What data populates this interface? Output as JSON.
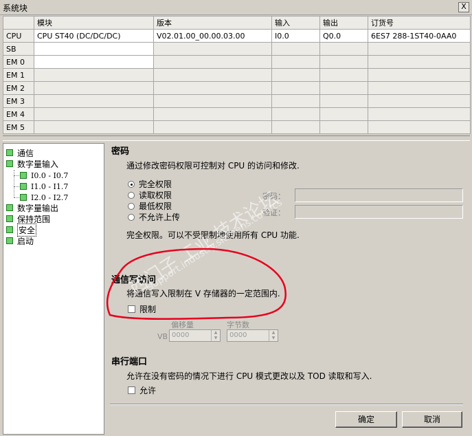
{
  "window": {
    "title": "系统块",
    "close_glyph": "X"
  },
  "grid": {
    "headers": [
      "",
      "模块",
      "版本",
      "输入",
      "输出",
      "订货号"
    ],
    "rows": [
      {
        "slot": "CPU",
        "module": "CPU ST40 (DC/DC/DC)",
        "version": "V02.01.00_00.00.03.00",
        "input": "I0.0",
        "output": "Q0.0",
        "order": "6ES7 288-1ST40-0AA0"
      },
      {
        "slot": "SB",
        "module": "",
        "version": "",
        "input": "",
        "output": "",
        "order": ""
      },
      {
        "slot": "EM 0",
        "module": "",
        "version": "",
        "input": "",
        "output": "",
        "order": ""
      },
      {
        "slot": "EM 1",
        "module": "",
        "version": "",
        "input": "",
        "output": "",
        "order": ""
      },
      {
        "slot": "EM 2",
        "module": "",
        "version": "",
        "input": "",
        "output": "",
        "order": ""
      },
      {
        "slot": "EM 3",
        "module": "",
        "version": "",
        "input": "",
        "output": "",
        "order": ""
      },
      {
        "slot": "EM 4",
        "module": "",
        "version": "",
        "input": "",
        "output": "",
        "order": ""
      },
      {
        "slot": "EM 5",
        "module": "",
        "version": "",
        "input": "",
        "output": "",
        "order": ""
      }
    ]
  },
  "tree": {
    "items": [
      {
        "label": "通信",
        "level": 0
      },
      {
        "label": "数字量输入",
        "level": 0
      },
      {
        "label": "I0.0 - I0.7",
        "level": 1
      },
      {
        "label": "I1.0 - I1.7",
        "level": 1
      },
      {
        "label": "I2.0 - I2.7",
        "level": 1
      },
      {
        "label": "数字量输出",
        "level": 0
      },
      {
        "label": "保持范围",
        "level": 0
      },
      {
        "label": "安全",
        "level": 0,
        "selected": true
      },
      {
        "label": "启动",
        "level": 0
      }
    ]
  },
  "password": {
    "title": "密码",
    "description": "通过修改密码权限可控制对 CPU 的访问和修改.",
    "options": [
      "完全权限",
      "读取权限",
      "最低权限",
      "不允许上传"
    ],
    "selected_index": 0,
    "password_label": "密码：",
    "verify_label": "验证：",
    "status": "完全权限。可以不受限制地使用所有 CPU 功能."
  },
  "comm": {
    "title": "通信写访问",
    "description": "将通信写入限制在 V 存储器的一定范围内.",
    "restrict_label": "限制",
    "offset_label": "偏移量",
    "bytes_label": "字节数",
    "vb_label": "VB",
    "offset_value": "0000",
    "bytes_value": "0000"
  },
  "serial": {
    "title": "串行端口",
    "description": "允许在没有密码的情况下进行 CPU 模式更改以及 TOD 读取和写入.",
    "allow_label": "允许"
  },
  "buttons": {
    "ok": "确定",
    "cancel": "取消"
  },
  "watermark": {
    "line1": "西门子 工业 技术论坛",
    "line2": "support.industry.siemens.com/cs"
  },
  "colors": {
    "annotation": "#e8001c",
    "tree_box": "#6cd06c"
  }
}
